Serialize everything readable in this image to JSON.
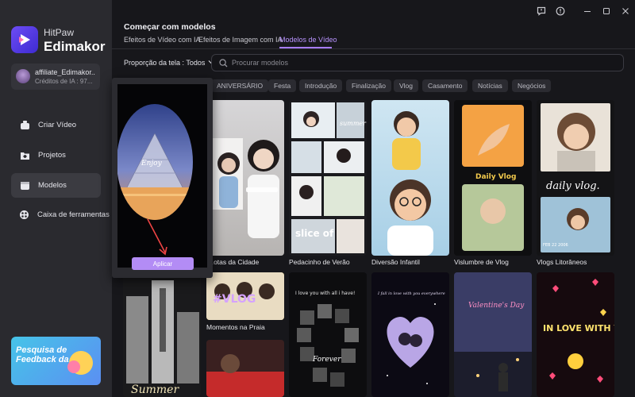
{
  "app": {
    "brand": "HitPaw",
    "name": "Edimakor"
  },
  "account": {
    "name": "affiliate_Edimakor..",
    "credits": "Créditos de IA : 97..."
  },
  "nav": [
    {
      "label": "Criar Vídeo",
      "icon": "create-video-icon"
    },
    {
      "label": "Projetos",
      "icon": "projects-icon"
    },
    {
      "label": "Modelos",
      "icon": "templates-icon",
      "active": true
    },
    {
      "label": "Caixa de ferramentas",
      "icon": "toolbox-icon"
    }
  ],
  "feedback": {
    "text": "Pesquisa de Feedback da"
  },
  "header": {
    "title": "Começar com modelos",
    "tabs": [
      "Efeitos de Vídeo com IA",
      "Efeitos de Imagem com IA",
      "Modelos de Vídeo"
    ],
    "active_tab": "Modelos de Vídeo"
  },
  "window_controls": [
    "feedback-icon",
    "settings-icon",
    "minimize-icon",
    "maximize-icon",
    "close-icon"
  ],
  "filter": {
    "ratio_label": "Proporção da tela : Todos"
  },
  "search": {
    "placeholder": "Procurar modelos",
    "value": ""
  },
  "categories": [
    "ANIVERSÁRIO",
    "Festa",
    "Introdução",
    "Finalização",
    "Vlog",
    "Casamento",
    "Notícias",
    "Negócios"
  ],
  "templates": [
    {
      "label": "...otas da Cidade"
    },
    {
      "label": "Pedacinho de Verão"
    },
    {
      "label": "Diversão Infantil"
    },
    {
      "label": "Vislumbre de Vlog"
    },
    {
      "label": "Vlogs Litorâneos"
    },
    {
      "label": ""
    },
    {
      "label": "Momentos na Praia"
    },
    {
      "label": ""
    },
    {
      "label": ""
    },
    {
      "label": ""
    },
    {
      "label": ""
    }
  ],
  "card_text": {
    "summer_vlog": "summer Vlog",
    "slice_life": "slice of life",
    "daily_vlog_badge": "Daily Vlog",
    "daily_vlog": "daily vlog.",
    "vlog": "#VLOG",
    "love_with_you": "I love you with all i have!",
    "forever": "Forever",
    "heart_caption": "I fall in love with you everywhere",
    "valentines": "Valentine's Day",
    "in_love": "IN LOVE WITH YOU?!",
    "summer": "Summer",
    "enjoy": "Enjoy",
    "date_stamp": "FEB 22 2006"
  },
  "preview": {
    "apply_label": "Aplicar"
  },
  "colors": {
    "accent": "#a77cff",
    "sidebar": "#2a2a2f",
    "background": "#17171b",
    "apply": "#b38cf5"
  }
}
